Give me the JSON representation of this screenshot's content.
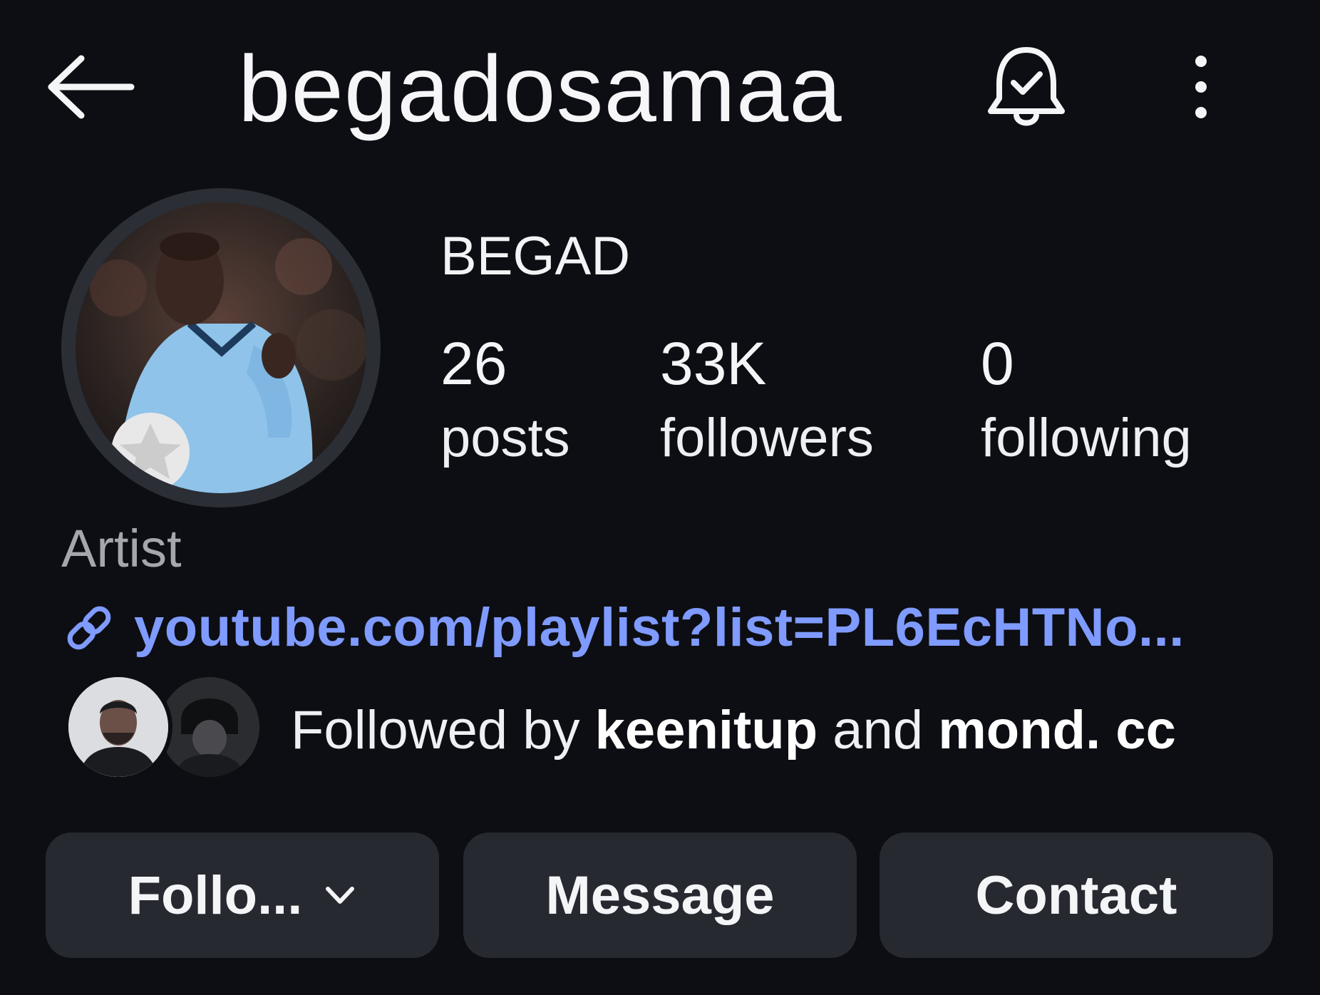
{
  "header": {
    "username": "begadosamaa",
    "icons": {
      "back": "arrow-left-icon",
      "notifications": "bell-check-icon",
      "more": "more-vertical-icon"
    }
  },
  "profile": {
    "display_name": "BEGAD",
    "avatar": "profile-avatar",
    "stats": {
      "posts": {
        "value": "26",
        "label": "posts"
      },
      "followers": {
        "value": "33K",
        "label": "followers"
      },
      "following": {
        "value": "0",
        "label": "following"
      }
    },
    "category": "Artist",
    "link": {
      "icon": "link-icon",
      "text": "youtube.com/playlist?list=PL6EcHTNo..."
    },
    "followed_by": {
      "prefix": "Followed by",
      "user1": "keenitup",
      "conjunction": "and",
      "user2": "mond. cc"
    }
  },
  "actions": {
    "follow_label": "Follo...",
    "message_label": "Message",
    "contact_label": "Contact"
  },
  "colors": {
    "background": "#0d0e13",
    "button_bg": "#272930",
    "link": "#7f9bff",
    "muted_text": "#a4a7ad"
  }
}
